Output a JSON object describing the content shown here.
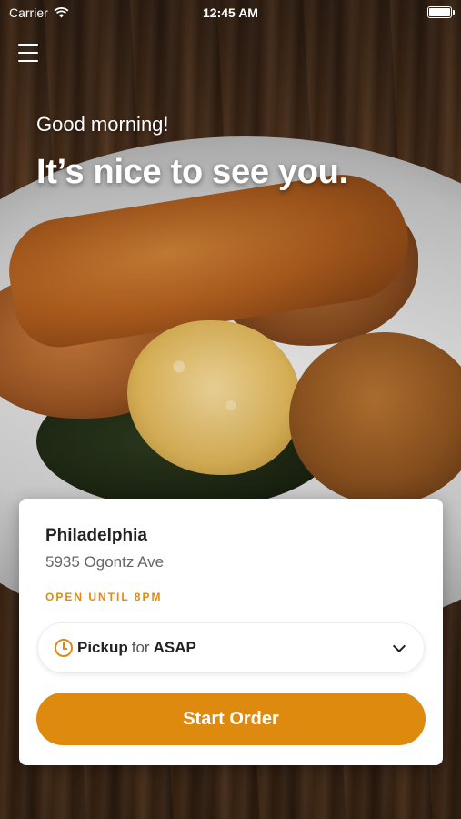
{
  "status_bar": {
    "carrier": "Carrier",
    "time": "12:45 AM",
    "battery_level": 1.0
  },
  "header": {
    "menu_icon": "hamburger-menu-icon",
    "greeting": "Good morning!",
    "headline": "It’s nice to see you."
  },
  "location_card": {
    "name": "Philadelphia",
    "address": "5935 Ogontz Ave",
    "hours": "OPEN UNTIL 8PM",
    "order_mode": {
      "mode": "Pickup",
      "connector": "for",
      "time": "ASAP",
      "icon": "clock-icon",
      "dropdown_icon": "chevron-down-icon"
    },
    "start_order_label": "Start Order"
  },
  "colors": {
    "accent": "#de8a0f",
    "text_dark": "#222222",
    "text_muted": "#666666",
    "card_bg": "#ffffff"
  }
}
